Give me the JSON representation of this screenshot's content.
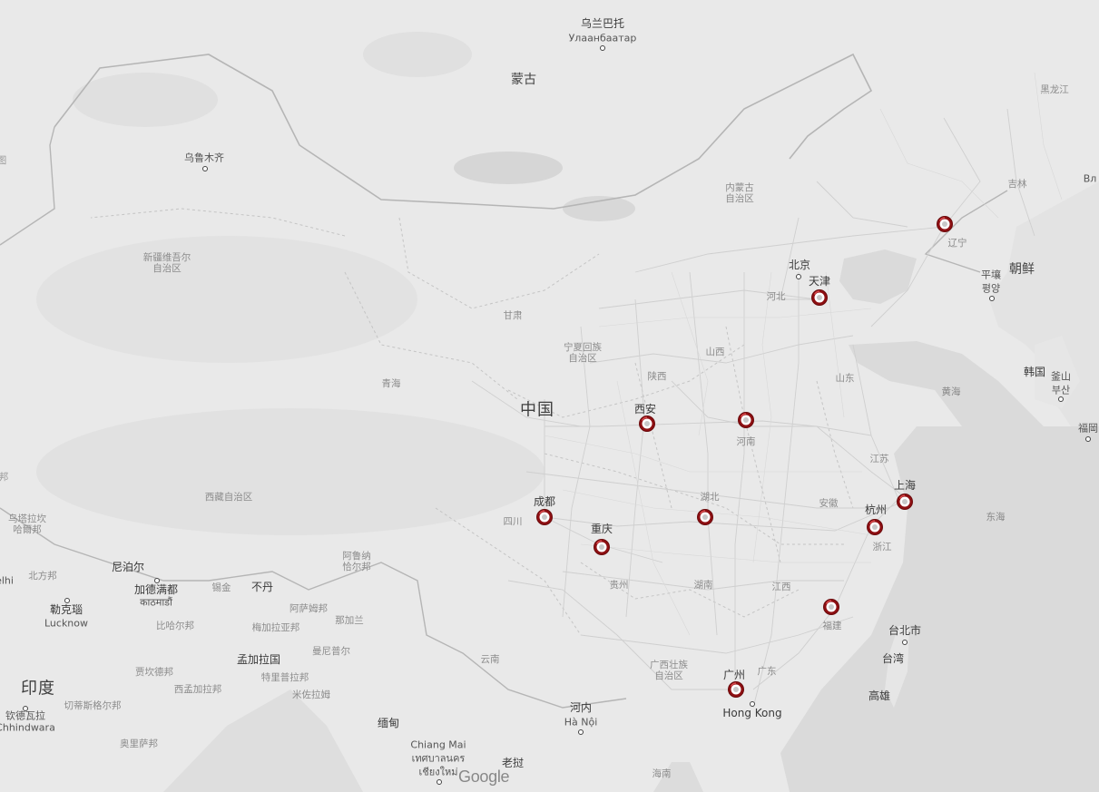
{
  "map": {
    "logo": "Google",
    "countries": {
      "mongolia": "蒙古",
      "china": "中国",
      "india": "印度",
      "north_korea": "朝鲜",
      "south_korea": "韩国",
      "bhutan": "不丹",
      "myanmar": "缅甸",
      "laos": "老挝",
      "bangladesh": "孟加拉国",
      "nepal": "尼泊尔"
    },
    "cities": {
      "ulaanbaatar_zh": "乌兰巴托",
      "ulaanbaatar_mn": "Улаанбаатар",
      "urumqi": "乌鲁木齐",
      "beijing": "北京",
      "tianjin": "天津",
      "xian": "西安",
      "chengdu": "成都",
      "chongqing": "重庆",
      "shanghai": "上海",
      "hangzhou": "杭州",
      "guangzhou": "广州",
      "hongkong": "Hong Kong",
      "taipei": "台北市",
      "taiwan": "台湾",
      "kaohsiung": "高雄",
      "hanoi_zh": "河内",
      "hanoi_vi": "Hà Nội",
      "pyongyang_zh": "平壤",
      "pyongyang_ko": "평양",
      "busan_zh": "釜山",
      "busan_ko": "부산",
      "fukuoka": "福岡",
      "kathmandu_zh": "加德满都",
      "kathmandu_ne": "काठमाडौं",
      "lucknow_zh": "勒克瑙",
      "lucknow_en": "Lucknow",
      "chiang_mai_en": "Chiang Mai",
      "chiang_mai_th1": "เทศบาลนคร",
      "chiang_mai_th2": "เชียงใหม่",
      "chhindwara_zh": "钦德瓦拉",
      "chhindwara_en": "Chhindwara",
      "delhi": "elhi",
      "vladivostok": "Вл",
      "left_edge_1": "图",
      "left_edge_2": "邦"
    },
    "regions": {
      "inner_mongolia": "内蒙古\n自治区",
      "heilongjiang": "黑龙江",
      "jilin": "吉林",
      "liaoning": "辽宁",
      "hebei": "河北",
      "shanxi": "山西",
      "shandong": "山东",
      "henan": "河南",
      "shaanxi": "陕西",
      "ningxia": "宁夏回族\n自治区",
      "gansu": "甘肃",
      "qinghai": "青海",
      "xinjiang": "新疆维吾尔\n自治区",
      "tibet": "西藏自治区",
      "sichuan": "四川",
      "guizhou": "贵州",
      "hubei": "湖北",
      "hunan": "湖南",
      "jiangxi": "江西",
      "anhui": "安徽",
      "jiangsu": "江苏",
      "zhejiang": "浙江",
      "fujian": "福建",
      "guangdong": "广东",
      "guangxi": "广西壮族\n自治区",
      "yunnan": "云南",
      "hainan": "海南",
      "arunachal": "阿鲁纳\n恰尔邦",
      "assam": "阿萨姆邦",
      "meghalaya": "梅加拉亚邦",
      "nagaland": "那加兰",
      "manipur": "曼尼普尔",
      "mizoram": "米佐拉姆",
      "tripura": "特里普拉邦",
      "west_bengal": "西孟加拉邦",
      "bihar": "比哈尔邦",
      "jharkhand": "贾坎德邦",
      "chhattisgarh": "切蒂斯格尔邦",
      "odisha": "奥里萨邦",
      "sikkim": "锡金",
      "uttarakhand": "北方邦",
      "uttarakhand2": "乌塔拉坎\n哈爾邦"
    },
    "waters": {
      "yellow_sea": "黄海",
      "east_sea": "东海"
    },
    "markers": [
      {
        "name": "liaoning-marker"
      },
      {
        "name": "tianjin-marker"
      },
      {
        "name": "xian-marker"
      },
      {
        "name": "henan-marker"
      },
      {
        "name": "chengdu-marker"
      },
      {
        "name": "chongqing-marker"
      },
      {
        "name": "hubei-marker"
      },
      {
        "name": "shanghai-marker"
      },
      {
        "name": "hangzhou-marker"
      },
      {
        "name": "fujian-marker"
      },
      {
        "name": "guangzhou-marker"
      }
    ]
  }
}
